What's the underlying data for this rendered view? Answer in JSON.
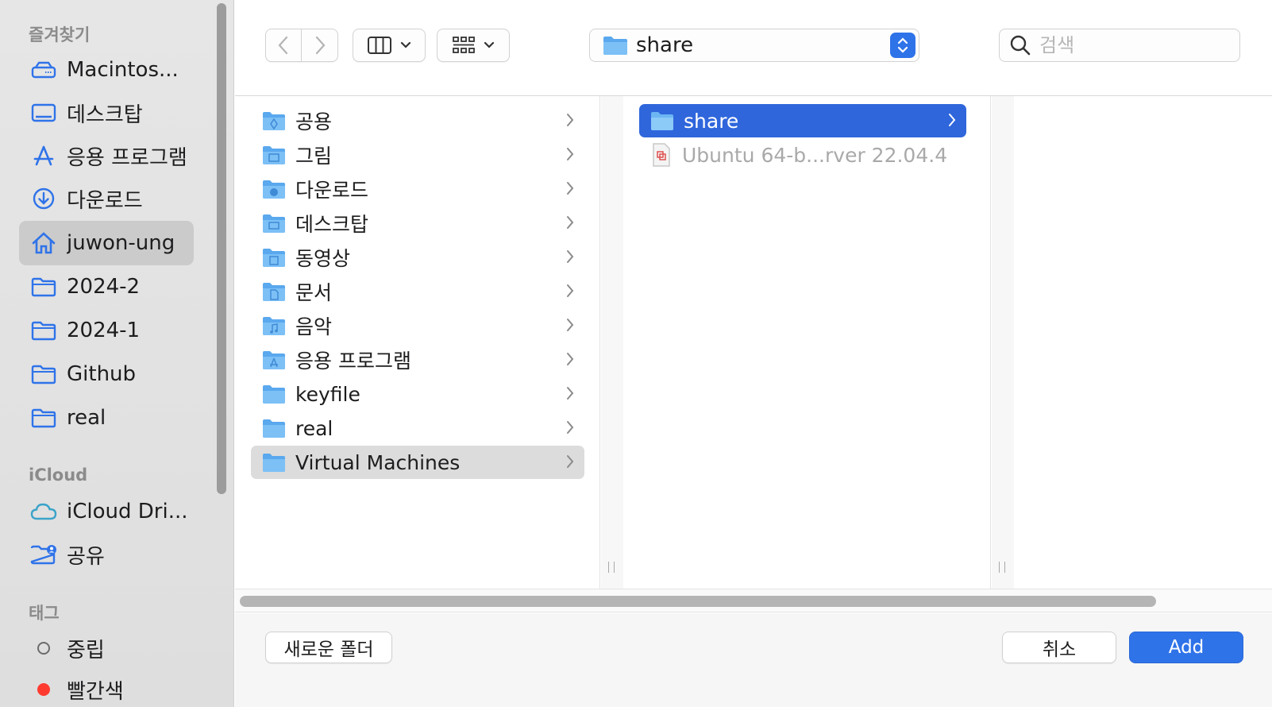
{
  "sidebar": {
    "favorites_title": "즐겨찾기",
    "favorites": [
      {
        "label": "Macintos...",
        "icon": "hard-drive-icon"
      },
      {
        "label": "데스크탑",
        "icon": "desktop-icon"
      },
      {
        "label": "응용 프로그램",
        "icon": "applications-icon"
      },
      {
        "label": "다운로드",
        "icon": "download-icon"
      },
      {
        "label": "juwon-ung",
        "icon": "home-icon",
        "active": true
      },
      {
        "label": "2024-2",
        "icon": "folder-icon"
      },
      {
        "label": "2024-1",
        "icon": "folder-icon"
      },
      {
        "label": "Github",
        "icon": "folder-icon"
      },
      {
        "label": "real",
        "icon": "folder-icon"
      }
    ],
    "icloud_title": "iCloud",
    "icloud": [
      {
        "label": "iCloud Dri...",
        "icon": "cloud-icon"
      },
      {
        "label": "공유",
        "icon": "shared-folder-icon"
      }
    ],
    "tags_title": "태그",
    "tags": [
      {
        "label": "중립",
        "color": "#ffffff"
      },
      {
        "label": "빨간색",
        "color": "#ff3b30"
      }
    ]
  },
  "toolbar": {
    "path_label": "share",
    "search_placeholder": "검색"
  },
  "column1": [
    {
      "label": "공용",
      "icon": "public-folder-icon"
    },
    {
      "label": "그림",
      "icon": "pictures-folder-icon"
    },
    {
      "label": "다운로드",
      "icon": "downloads-folder-icon"
    },
    {
      "label": "데스크탑",
      "icon": "desktop-folder-icon"
    },
    {
      "label": "동영상",
      "icon": "movies-folder-icon"
    },
    {
      "label": "문서",
      "icon": "documents-folder-icon"
    },
    {
      "label": "음악",
      "icon": "music-folder-icon"
    },
    {
      "label": "응용 프로그램",
      "icon": "applications-folder-icon"
    },
    {
      "label": "keyfile",
      "icon": "folder-icon"
    },
    {
      "label": "real",
      "icon": "folder-icon"
    },
    {
      "label": "Virtual Machines",
      "icon": "folder-icon",
      "selected": true
    }
  ],
  "column2": [
    {
      "label": "share",
      "icon": "folder-icon",
      "selected": true
    },
    {
      "label": "Ubuntu 64-b...rver 22.04.4",
      "icon": "vm-file-icon",
      "dim": true
    }
  ],
  "bottom": {
    "new_folder_label": "새로운 폴더",
    "cancel_label": "취소",
    "add_label": "Add"
  },
  "colors": {
    "accent": "#2f73e9",
    "selection": "#2f66dc",
    "folder": "#6cb6f2"
  }
}
